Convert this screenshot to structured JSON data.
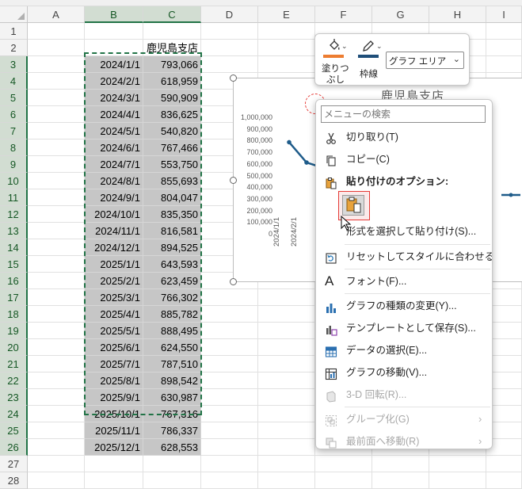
{
  "sheet": {
    "columns": [
      "A",
      "B",
      "C",
      "D",
      "E",
      "F",
      "G",
      "H",
      "I"
    ],
    "selected_columns": [
      "B",
      "C"
    ],
    "rows": [
      1,
      2,
      3,
      4,
      5,
      6,
      7,
      8,
      9,
      10,
      11,
      12,
      13,
      14,
      15,
      16,
      17,
      18,
      19,
      20,
      21,
      22,
      23,
      24,
      25,
      26,
      27,
      28
    ],
    "header_cell": "鹿児島支店",
    "data": [
      [
        "2024/1/1",
        "793,066"
      ],
      [
        "2024/2/1",
        "618,959"
      ],
      [
        "2024/3/1",
        "590,909"
      ],
      [
        "2024/4/1",
        "836,625"
      ],
      [
        "2024/5/1",
        "540,820"
      ],
      [
        "2024/6/1",
        "767,466"
      ],
      [
        "2024/7/1",
        "553,750"
      ],
      [
        "2024/8/1",
        "855,693"
      ],
      [
        "2024/9/1",
        "804,047"
      ],
      [
        "2024/10/1",
        "835,350"
      ],
      [
        "2024/11/1",
        "816,581"
      ],
      [
        "2024/12/1",
        "894,525"
      ],
      [
        "2025/1/1",
        "643,593"
      ],
      [
        "2025/2/1",
        "623,459"
      ],
      [
        "2025/3/1",
        "766,302"
      ],
      [
        "2025/4/1",
        "885,782"
      ],
      [
        "2025/5/1",
        "888,495"
      ],
      [
        "2025/6/1",
        "624,550"
      ],
      [
        "2025/7/1",
        "787,510"
      ],
      [
        "2025/8/1",
        "898,542"
      ],
      [
        "2025/9/1",
        "630,987"
      ],
      [
        "2025/10/1",
        "767,316"
      ],
      [
        "2025/11/1",
        "786,337"
      ],
      [
        "2025/12/1",
        "628,553"
      ]
    ]
  },
  "chart": {
    "title": "鹿児島支店",
    "yticks": [
      "1,000,000",
      "900,000",
      "800,000",
      "700,000",
      "600,000",
      "500,000",
      "400,000",
      "300,000",
      "200,000",
      "100,000",
      "0"
    ],
    "xticks": [
      "2024/1/1",
      "2024/2/1"
    ],
    "line_color": "#1f5c8a"
  },
  "mini_toolbar": {
    "fill_label_1": "塗りつ",
    "fill_label_2": "ぶし",
    "outline_label": "枠線",
    "element_select_value": "グラフ エリア"
  },
  "context_menu": {
    "search_placeholder": "メニューの検索",
    "items": [
      {
        "label": "切り取り(T)",
        "icon": "scissors-icon",
        "enabled": true
      },
      {
        "label": "コピー(C)",
        "icon": "copy-icon",
        "enabled": true
      },
      {
        "label": "貼り付けのオプション:",
        "icon": "paste-icon",
        "enabled": true
      },
      {
        "label": "形式を選択して貼り付け(S)...",
        "icon": "",
        "enabled": true
      },
      {
        "label": "リセットしてスタイルに合わせる(A)",
        "icon": "reset-style-icon",
        "enabled": true
      },
      {
        "label": "フォント(F)...",
        "icon": "font-icon",
        "enabled": true
      },
      {
        "label": "グラフの種類の変更(Y)...",
        "icon": "chart-type-icon",
        "enabled": true
      },
      {
        "label": "テンプレートとして保存(S)...",
        "icon": "template-icon",
        "enabled": true
      },
      {
        "label": "データの選択(E)...",
        "icon": "select-data-icon",
        "enabled": true
      },
      {
        "label": "グラフの移動(V)...",
        "icon": "move-chart-icon",
        "enabled": true
      },
      {
        "label": "3-D 回転(R)...",
        "icon": "rotate-3d-icon",
        "enabled": false
      },
      {
        "label": "グループ化(G)",
        "icon": "group-icon",
        "enabled": false
      },
      {
        "label": "最前面へ移動(R)",
        "icon": "bring-front-icon",
        "enabled": false
      }
    ]
  }
}
